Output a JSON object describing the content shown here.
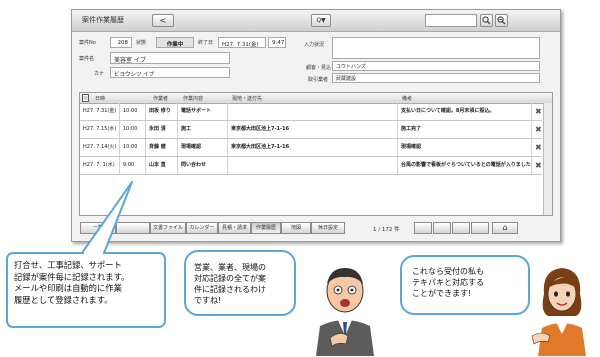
{
  "window": {
    "title": "案件作業履歴",
    "back_symbol": "<",
    "filter_symbol": "Q▼"
  },
  "header": {
    "case_no_label": "案件No",
    "case_no": "208",
    "status_label": "状態",
    "status": "作業中",
    "complete_label": "終了日",
    "complete_date": "H27. 7.31(金)",
    "complete_time": "9:47",
    "name_label": "案件名",
    "name": "美容室 イブ",
    "kana_label": "カナ",
    "kana": "ビヨウシツ イブ",
    "input_status_label": "入力状況",
    "client_label": "顧客・見込",
    "client": "ユウトハンズ",
    "vendor_label": "取引業者",
    "vendor": "武蔵建設"
  },
  "table": {
    "columns": [
      "日時",
      "",
      "作業者",
      "作業内容",
      "現地・送付先",
      "備考"
    ],
    "rows": [
      {
        "date": "H27. 7.31(金)",
        "time": "10:00",
        "worker": "田坂 修り",
        "task": "電話サポート",
        "place": "",
        "note": "支払い日について確認。8月末頃に振込。"
      },
      {
        "date": "H27. 7.15(水)",
        "time": "10:00",
        "worker": "永田 清",
        "task": "施工",
        "place": "東京都大田区池上7-1-16",
        "note": "施工完了"
      },
      {
        "date": "H27. 7.14(火)",
        "time": "10:00",
        "worker": "斉藤 健",
        "task": "現場確認",
        "place": "東京都大田区池上7-1-16",
        "note": "現場確認"
      },
      {
        "date": "H27. 7. 1(水)",
        "time": "9:00",
        "worker": "山本 直",
        "task": "問い合わせ",
        "place": "",
        "note": "台風の影響で看板がぐらついているとの電話が入りました(店長)"
      }
    ]
  },
  "footer": {
    "tabs": [
      "一覧",
      "",
      "文書ファイル",
      "カレンダー",
      "見積・請求",
      "作業履歴",
      "地図",
      "休日設定"
    ],
    "active_tab": "作業履歴",
    "page_info": "1 / 172 件",
    "home_symbol": "⌂"
  },
  "callouts": {
    "left": [
      "打合せ、工事記録、サポート",
      "記録が案件毎に記録されます。",
      "メールや印刷は自動的に作業",
      "履歴として登録されます。"
    ],
    "middle": [
      "営業、業者、現場の",
      "対応記録の全てが案",
      "件に記録されるわけ",
      "ですね!"
    ],
    "right": [
      "これなら受付の私も",
      "テキパキと対応する",
      "ことができます!"
    ]
  },
  "colors": {
    "bubble_border": "#5aa7d8",
    "window_bg": "#f2f2f2"
  }
}
